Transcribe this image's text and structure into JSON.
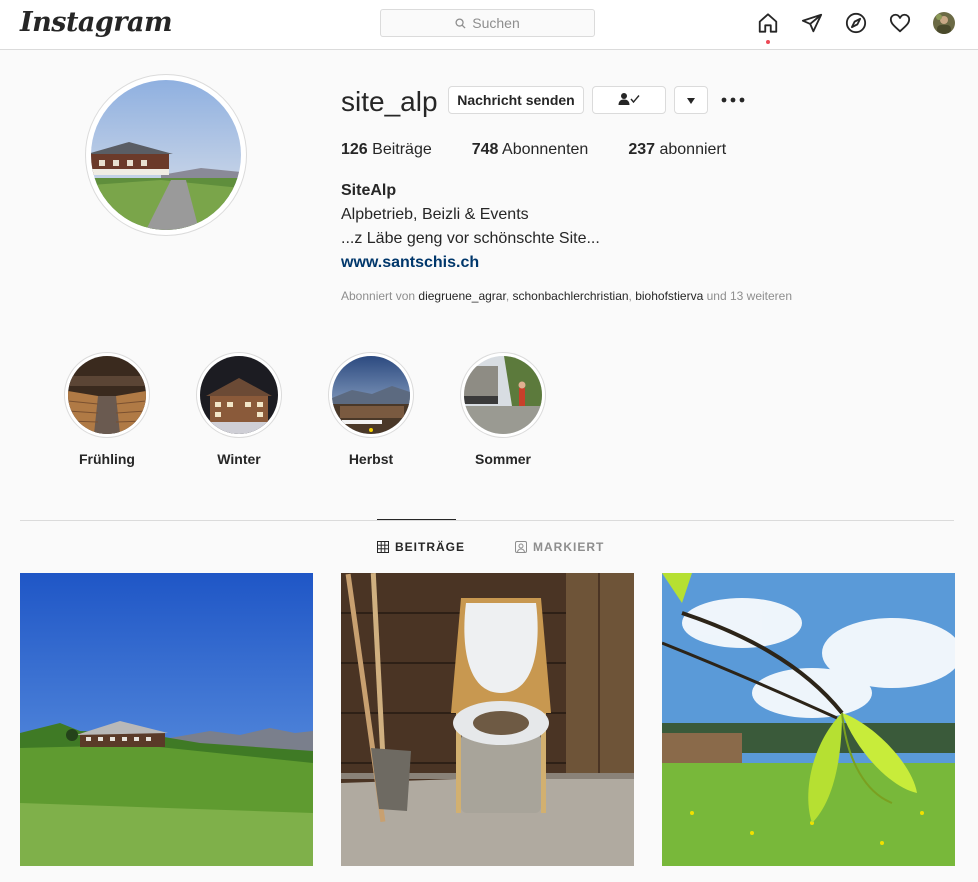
{
  "nav": {
    "logo": "Instagram",
    "search_placeholder": "Suchen"
  },
  "profile": {
    "username": "site_alp",
    "message_button": "Nachricht senden",
    "stats": {
      "posts_count": "126",
      "posts_label": "Beiträge",
      "followers_count": "748",
      "followers_label": "Abonnenten",
      "following_count": "237",
      "following_label": "abonniert"
    },
    "full_name": "SiteAlp",
    "bio_line1": "Alpbetrieb, Beizli & Events",
    "bio_line2": "...z Läbe geng vor schönschte Site...",
    "website": "www.santschis.ch",
    "followed_by": {
      "prefix": "Abonniert von",
      "user1": "diegruene_agrar",
      "user2": "schonbachlerchristian",
      "user3": "biohofstierva",
      "suffix": "und 13 weiteren"
    }
  },
  "highlights": [
    {
      "label": "Frühling"
    },
    {
      "label": "Winter"
    },
    {
      "label": "Herbst"
    },
    {
      "label": "Sommer"
    }
  ],
  "tabs": {
    "posts": "BEITRÄGE",
    "tagged": "MARKIERT"
  },
  "icons": {
    "search": "search-icon",
    "home": "home-icon",
    "direct": "paper-plane-icon",
    "explore": "compass-icon",
    "activity": "heart-icon",
    "follow_status": "person-check-icon",
    "dropdown": "caret-down-icon",
    "more": "more-dots-icon",
    "grid": "grid-icon",
    "tagged": "tag-person-icon"
  },
  "colors": {
    "link": "#00376b",
    "text": "#262626",
    "muted": "#8e8e8e",
    "border": "#dbdbdb",
    "notification": "#ed4956"
  }
}
